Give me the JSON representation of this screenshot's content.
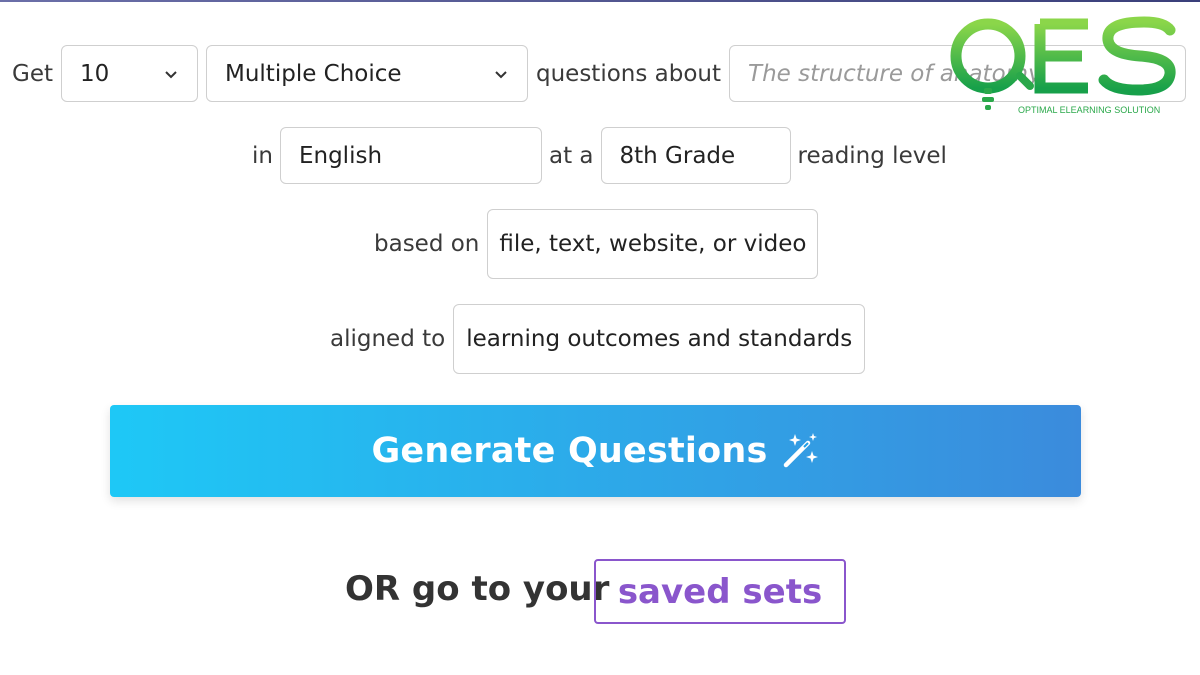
{
  "row1": {
    "prefix": "Get",
    "count_value": "10",
    "type_value": "Multiple Choice",
    "middle": "questions about",
    "topic_placeholder": "The structure of anatomy"
  },
  "row2": {
    "prefix": "in",
    "language_value": "English",
    "middle": "at a",
    "grade_value": "8th Grade",
    "suffix": "reading level"
  },
  "row3": {
    "prefix": "based on",
    "source_label": "file, text, website, or video"
  },
  "row4": {
    "prefix": "aligned to",
    "outcomes_label": "learning outcomes and standards"
  },
  "generate_button": {
    "label": "Generate Questions",
    "icon": "magic-wand-icon"
  },
  "saved": {
    "prefix": "OR go to your",
    "link_label": "saved sets"
  },
  "logo": {
    "letters": "OES",
    "tagline": "OPTIMAL ELEARNING SOLUTION"
  },
  "colors": {
    "gradient_start": "#1ec8f6",
    "gradient_end": "#3b8bdc",
    "saved_accent": "#8a56cc",
    "logo_green": "#3cb043"
  }
}
